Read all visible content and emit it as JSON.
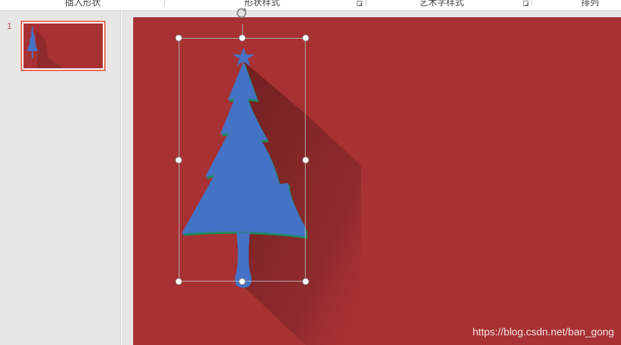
{
  "ribbon": {
    "groups": [
      {
        "label": "插入形状"
      },
      {
        "label": "形状样式"
      },
      {
        "label": "艺术字样式"
      },
      {
        "label": "排列"
      }
    ]
  },
  "thumbnails": {
    "slides": [
      {
        "number": "1",
        "selected": true
      }
    ]
  },
  "slide": {
    "background_color": "#a83133",
    "shape": {
      "name": "christmas-tree",
      "fill_color": "#4472c4",
      "edge_color": "#1f8a5a",
      "selected": true
    }
  },
  "watermark": "https://blog.csdn.net/ban_gong"
}
